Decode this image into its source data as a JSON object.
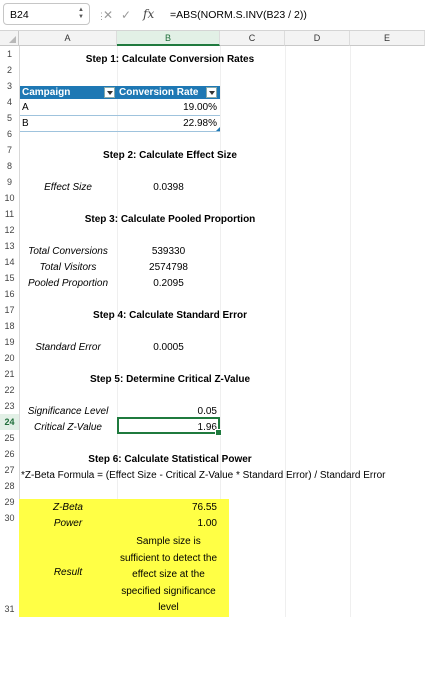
{
  "formula_bar": {
    "name_box": "B24",
    "formula": "=ABS(NORM.S.INV(B23 / 2))",
    "cancel_icon": "✕",
    "enter_icon": "✓",
    "fx_label": "fx"
  },
  "columns": [
    "A",
    "B",
    "C",
    "D",
    "E"
  ],
  "rows": [
    "1",
    "2",
    "3",
    "4",
    "5",
    "6",
    "7",
    "8",
    "9",
    "10",
    "11",
    "12",
    "13",
    "14",
    "15",
    "16",
    "17",
    "18",
    "19",
    "20",
    "21",
    "22",
    "23",
    "24",
    "25",
    "26",
    "27",
    "28",
    "29",
    "30",
    "31"
  ],
  "selected_cell": "B24",
  "sheet": {
    "step1": "Step 1: Calculate Conversion Rates",
    "table_header_campaign": "Campaign",
    "table_header_rate": "Conversion Rate",
    "row_a_campaign": "A",
    "row_a_rate": "19.00%",
    "row_b_campaign": "B",
    "row_b_rate": "22.98%",
    "step2": "Step 2: Calculate Effect Size",
    "effect_size_label": "Effect Size",
    "effect_size_value": "0.0398",
    "step3": "Step 3: Calculate Pooled Proportion",
    "total_conversions_label": "Total Conversions",
    "total_conversions_value": "539330",
    "total_visitors_label": "Total Visitors",
    "total_visitors_value": "2574798",
    "pooled_label": "Pooled Proportion",
    "pooled_value": "0.2095",
    "step4": "Step 4: Calculate Standard Error",
    "std_error_label": "Standard Error",
    "std_error_value": "0.0005",
    "step5": "Step 5: Determine Critical Z-Value",
    "sig_level_label": "Significance Level",
    "sig_level_value": "0.05",
    "crit_z_label": "Critical Z-Value",
    "crit_z_value": "1.96",
    "step6": "Step 6: Calculate Statistical Power",
    "zbeta_formula_note": "*Z-Beta Formula = (Effect Size - Critical Z-Value * Standard Error) / Standard Error",
    "zbeta_label": "Z-Beta",
    "zbeta_value": "76.55",
    "power_label": "Power",
    "power_value": "1.00",
    "result_label": "Result",
    "result_value": "Sample size is sufficient to detect the effect size at the specified significance level"
  },
  "colors": {
    "table_header_bg": "#1e78b4",
    "highlight_yellow": "#ffff45",
    "selection_green": "#1f7a3e"
  }
}
